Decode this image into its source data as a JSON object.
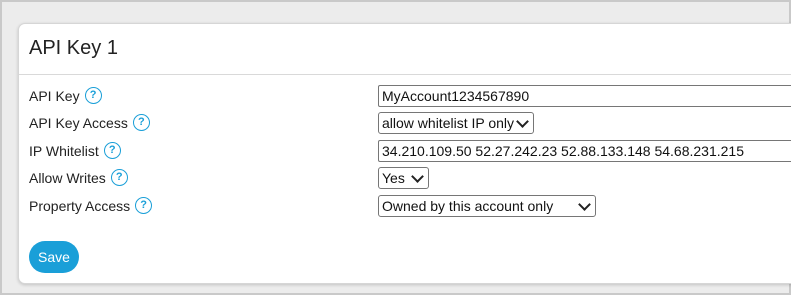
{
  "panel": {
    "title": "API Key 1",
    "save_label": "Save"
  },
  "help_glyph": "?",
  "fields": {
    "api_key": {
      "label": "API Key",
      "value": "MyAccount1234567890"
    },
    "api_key_access": {
      "label": "API Key Access",
      "value": "allow whitelist IP only"
    },
    "ip_whitelist": {
      "label": "IP Whitelist",
      "value": "34.210.109.50 52.27.242.23 52.88.133.148 54.68.231.215"
    },
    "allow_writes": {
      "label": "Allow Writes",
      "value": "Yes"
    },
    "property_access": {
      "label": "Property Access",
      "value": "Owned by this account only"
    }
  },
  "colors": {
    "accent": "#1a9fd8",
    "background": "#ececec",
    "panel": "#ffffff"
  }
}
